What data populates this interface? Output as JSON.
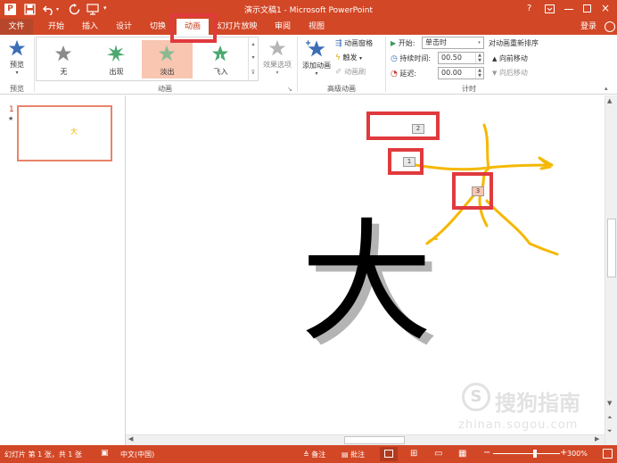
{
  "window": {
    "title": "演示文稿1 - Microsoft PowerPoint",
    "help_icon": "?",
    "sign_in": "登录"
  },
  "tabs": [
    {
      "label": "文件"
    },
    {
      "label": "开始"
    },
    {
      "label": "插入"
    },
    {
      "label": "设计"
    },
    {
      "label": "切换"
    },
    {
      "label": "动画"
    },
    {
      "label": "幻灯片放映"
    },
    {
      "label": "审阅"
    },
    {
      "label": "视图"
    }
  ],
  "ribbon": {
    "preview": {
      "button": "预览",
      "group": "预览"
    },
    "animation": {
      "group": "动画",
      "gallery": [
        {
          "label": "无",
          "color": "#8a8a8a"
        },
        {
          "label": "出现",
          "color": "#4aa86e"
        },
        {
          "label": "淡出",
          "color": "#6fb589"
        },
        {
          "label": "飞入",
          "color": "#4aa86e"
        }
      ],
      "effect_options": "效果选项"
    },
    "advanced": {
      "group": "高级动画",
      "add_animation": "添加动画",
      "animation_pane": "动画窗格",
      "trigger": "触发",
      "painter": "动画刷"
    },
    "timing": {
      "group": "计时",
      "start_label": "开始:",
      "start_value": "单击时",
      "duration_label": "持续时间:",
      "duration_value": "00.50",
      "delay_label": "延迟:",
      "delay_value": "00.00",
      "reorder_title": "对动画重新排序",
      "move_earlier": "向前移动",
      "move_later": "向后移动"
    }
  },
  "thumbnails": [
    {
      "number": "1",
      "star": "★",
      "text": "大"
    }
  ],
  "slide": {
    "character": "大",
    "tags": [
      "2",
      "1",
      "3"
    ]
  },
  "status": {
    "slide_info": "幻灯片 第 1 张，共 1 张",
    "language": "中文(中国)",
    "notes": "备注",
    "comments": "批注",
    "zoom": "300%",
    "minus": "−",
    "plus": "+"
  },
  "watermark": {
    "brand": "搜狗指南",
    "url": "zhinan.sogou.com"
  },
  "colors": {
    "accent": "#d24726",
    "path": "#f5b800",
    "highlight_box": "#e03a3e"
  }
}
